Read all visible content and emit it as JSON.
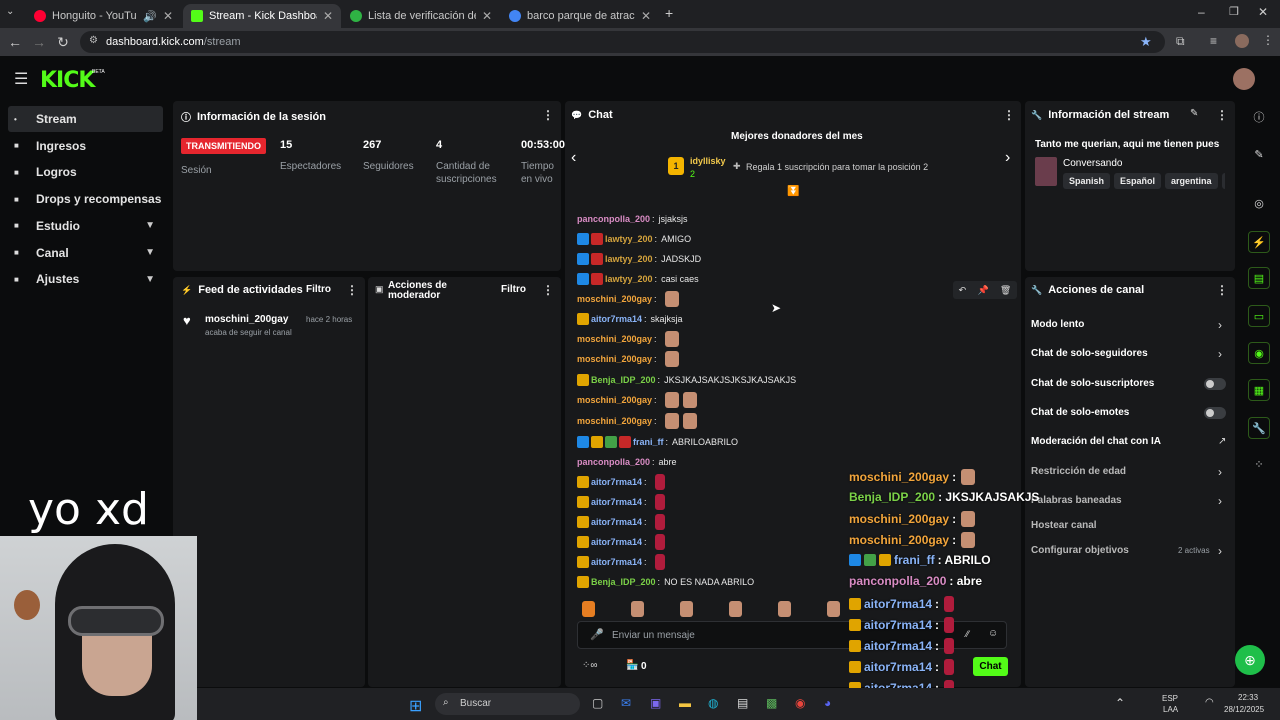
{
  "browser": {
    "tabs": [
      {
        "label": "Honguito - YouTube Music",
        "color": "#ff0033"
      },
      {
        "label": "Stream - Kick Dashboard",
        "color": "#53fc18",
        "active": true
      },
      {
        "label": "Lista de verificación de vida",
        "color": "#2fb344"
      },
      {
        "label": "barco parque de atracciones - B",
        "color": "#4285f4"
      }
    ],
    "url_host": "dashboard.kick.com",
    "url_path": "/stream"
  },
  "kick": {
    "logo": "KICK",
    "beta": "BETA",
    "sidebar": [
      {
        "label": "Stream",
        "icon": "broadcast-icon",
        "active": true
      },
      {
        "label": "Ingresos",
        "icon": "wallet-icon"
      },
      {
        "label": "Logros",
        "icon": "trophy-icon"
      },
      {
        "label": "Drops y recompensas",
        "icon": "gift-icon"
      },
      {
        "label": "Estudio",
        "icon": "palette-icon",
        "expand": true
      },
      {
        "label": "Canal",
        "icon": "channel-icon",
        "expand": true
      },
      {
        "label": "Ajustes",
        "icon": "gear-icon",
        "expand": true
      }
    ]
  },
  "session": {
    "title": "Información de la sesión",
    "status": "TRANSMITIENDO",
    "status_label": "Sesión",
    "stats": [
      {
        "value": "15",
        "label": "Espectadores"
      },
      {
        "value": "267",
        "label": "Seguidores"
      },
      {
        "value": "4",
        "label": "Cantidad de suscripciones"
      },
      {
        "value": "00:53:00",
        "label": "Tiempo en vivo"
      }
    ]
  },
  "feed": {
    "title": "Feed de actividades",
    "filter": "Filtro",
    "item_user": "moschini_200gay",
    "item_time": "hace 2 horas",
    "item_desc": "acaba de seguir el canal"
  },
  "modactions": {
    "title_line1": "Acciones de",
    "title_line2": "moderador",
    "filter": "Filtro"
  },
  "chat": {
    "title": "Chat",
    "donors_title": "Mejores donadores del mes",
    "donor_name": "idyllisky",
    "donor_count": "2",
    "donor_rank": "1",
    "gift_prompt": "Regala 1 suscripción para tomar la posición 2",
    "messages": [
      {
        "user": "panconpolla_200",
        "text": "jsjaksjs",
        "color": "#d98cc4",
        "badges": []
      },
      {
        "user": "lawtyy_200",
        "text": "AMIGO",
        "color": "#d4a33d",
        "badges": [
          "blue",
          "red"
        ]
      },
      {
        "user": "lawtyy_200",
        "text": "JADSKJD",
        "color": "#d4a33d",
        "badges": [
          "blue",
          "red"
        ]
      },
      {
        "user": "lawtyy_200",
        "text": "casi caes",
        "color": "#d4a33d",
        "badges": [
          "blue",
          "red"
        ]
      },
      {
        "user": "moschini_200gay",
        "text": "",
        "color": "#f2a53c",
        "badges": [],
        "emotes": 1
      },
      {
        "user": "aitor7rma14",
        "text": "skajksja",
        "color": "#8ab4f8",
        "badges": [
          "gold"
        ]
      },
      {
        "user": "moschini_200gay",
        "text": "",
        "color": "#f2a53c",
        "badges": [],
        "emotes": 1
      },
      {
        "user": "moschini_200gay",
        "text": "",
        "color": "#f2a53c",
        "badges": [],
        "emotes": 1
      },
      {
        "user": "Benja_IDP_200",
        "text": "JKSJKAJSAKJSJKSJKAJSAKJS",
        "color": "#7bd148",
        "badges": [
          "gold"
        ]
      },
      {
        "user": "moschini_200gay",
        "text": "",
        "color": "#f2a53c",
        "badges": [],
        "emotes": 2
      },
      {
        "user": "moschini_200gay",
        "text": "",
        "color": "#f2a53c",
        "badges": [],
        "emotes": 2
      },
      {
        "user": "frani_ff",
        "text": "ABRILOABRILO",
        "color": "#8ab4f8",
        "badges": [
          "blue",
          "gold",
          "green",
          "red"
        ]
      },
      {
        "user": "panconpolla_200",
        "text": "abre",
        "color": "#d98cc4",
        "badges": []
      },
      {
        "user": "aitor7rma14",
        "text": "",
        "color": "#8ab4f8",
        "badges": [
          "gold"
        ],
        "red": true
      },
      {
        "user": "aitor7rma14",
        "text": "",
        "color": "#8ab4f8",
        "badges": [
          "gold"
        ],
        "red": true
      },
      {
        "user": "aitor7rma14",
        "text": "",
        "color": "#8ab4f8",
        "badges": [
          "gold"
        ],
        "red": true
      },
      {
        "user": "aitor7rma14",
        "text": "",
        "color": "#8ab4f8",
        "badges": [
          "gold"
        ],
        "red": true
      },
      {
        "user": "aitor7rma14",
        "text": "",
        "color": "#8ab4f8",
        "badges": [
          "gold"
        ],
        "red": true
      },
      {
        "user": "Benja_IDP_200",
        "text": "NO ES NADA ABRILO",
        "color": "#7bd148",
        "badges": [
          "gold"
        ]
      }
    ],
    "input_placeholder": "Enviar un mensaje",
    "points": "0",
    "send": "Chat"
  },
  "overlay": {
    "caption": "yo xd",
    "messages": [
      {
        "user": "moschini_200gay",
        "text": ":",
        "color": "#f2a53c",
        "badges": [],
        "emote": true
      },
      {
        "user": "Benja_IDP_200",
        "text": ": JKSJKAJSAKJS",
        "color": "#7bd148",
        "badges": []
      },
      {
        "user": "moschini_200gay",
        "text": ":",
        "color": "#f2a53c",
        "badges": [],
        "emote": true
      },
      {
        "user": "moschini_200gay",
        "text": ":",
        "color": "#f2a53c",
        "badges": [],
        "emote": true
      },
      {
        "user": "frani_ff",
        "text": ": ABRILO",
        "color": "#8ab4f8",
        "badges": [
          "blue",
          "green",
          "gold"
        ]
      },
      {
        "user": "panconpolla_200",
        "text": ": abre",
        "color": "#d98cc4",
        "badges": []
      },
      {
        "user": "aitor7rma14",
        "text": ":",
        "color": "#8ab4f8",
        "badges": [
          "gold"
        ],
        "red": true
      },
      {
        "user": "aitor7rma14",
        "text": ":",
        "color": "#8ab4f8",
        "badges": [
          "gold"
        ],
        "red": true
      },
      {
        "user": "aitor7rma14",
        "text": ":",
        "color": "#8ab4f8",
        "badges": [
          "gold"
        ],
        "red": true
      },
      {
        "user": "aitor7rma14",
        "text": ":",
        "color": "#8ab4f8",
        "badges": [
          "gold"
        ],
        "red": true
      },
      {
        "user": "aitor7rma14",
        "text": ":",
        "color": "#8ab4f8",
        "badges": [
          "gold"
        ],
        "red": true
      },
      {
        "user": "Benja_IDP_200",
        "text": ": NO ES NADA ABRILO",
        "color": "#7bd148",
        "badges": []
      }
    ]
  },
  "streaminfo": {
    "title": "Información del stream",
    "stream_title": "Tanto me querian, aqui me tienen pues",
    "category": "Conversando",
    "tags": [
      "Spanish",
      "Español",
      "argentina",
      "ch"
    ]
  },
  "channelactions": {
    "title": "Acciones de canal",
    "items": [
      {
        "label": "Modo lento",
        "kind": "chevron"
      },
      {
        "label": "Chat de solo-seguidores",
        "kind": "chevron"
      },
      {
        "label": "Chat de solo-suscriptores",
        "kind": "toggle"
      },
      {
        "label": "Chat de solo-emotes",
        "kind": "toggle"
      },
      {
        "label": "Moderación del chat con IA",
        "kind": "external"
      },
      {
        "label": "Restricción de edad",
        "kind": "chevron",
        "dim": true
      },
      {
        "label": "Palabras baneadas",
        "kind": "chevron",
        "dim": true
      },
      {
        "label": "Hostear canal",
        "kind": "none",
        "dim": true
      },
      {
        "label": "Configurar objetivos",
        "kind": "chevron",
        "dim": true,
        "extra": "2 activas"
      }
    ]
  },
  "taskbar": {
    "search": "Buscar",
    "lang1": "ESP",
    "lang2": "LAA",
    "time": "22:33",
    "date": "28/12/2025"
  }
}
